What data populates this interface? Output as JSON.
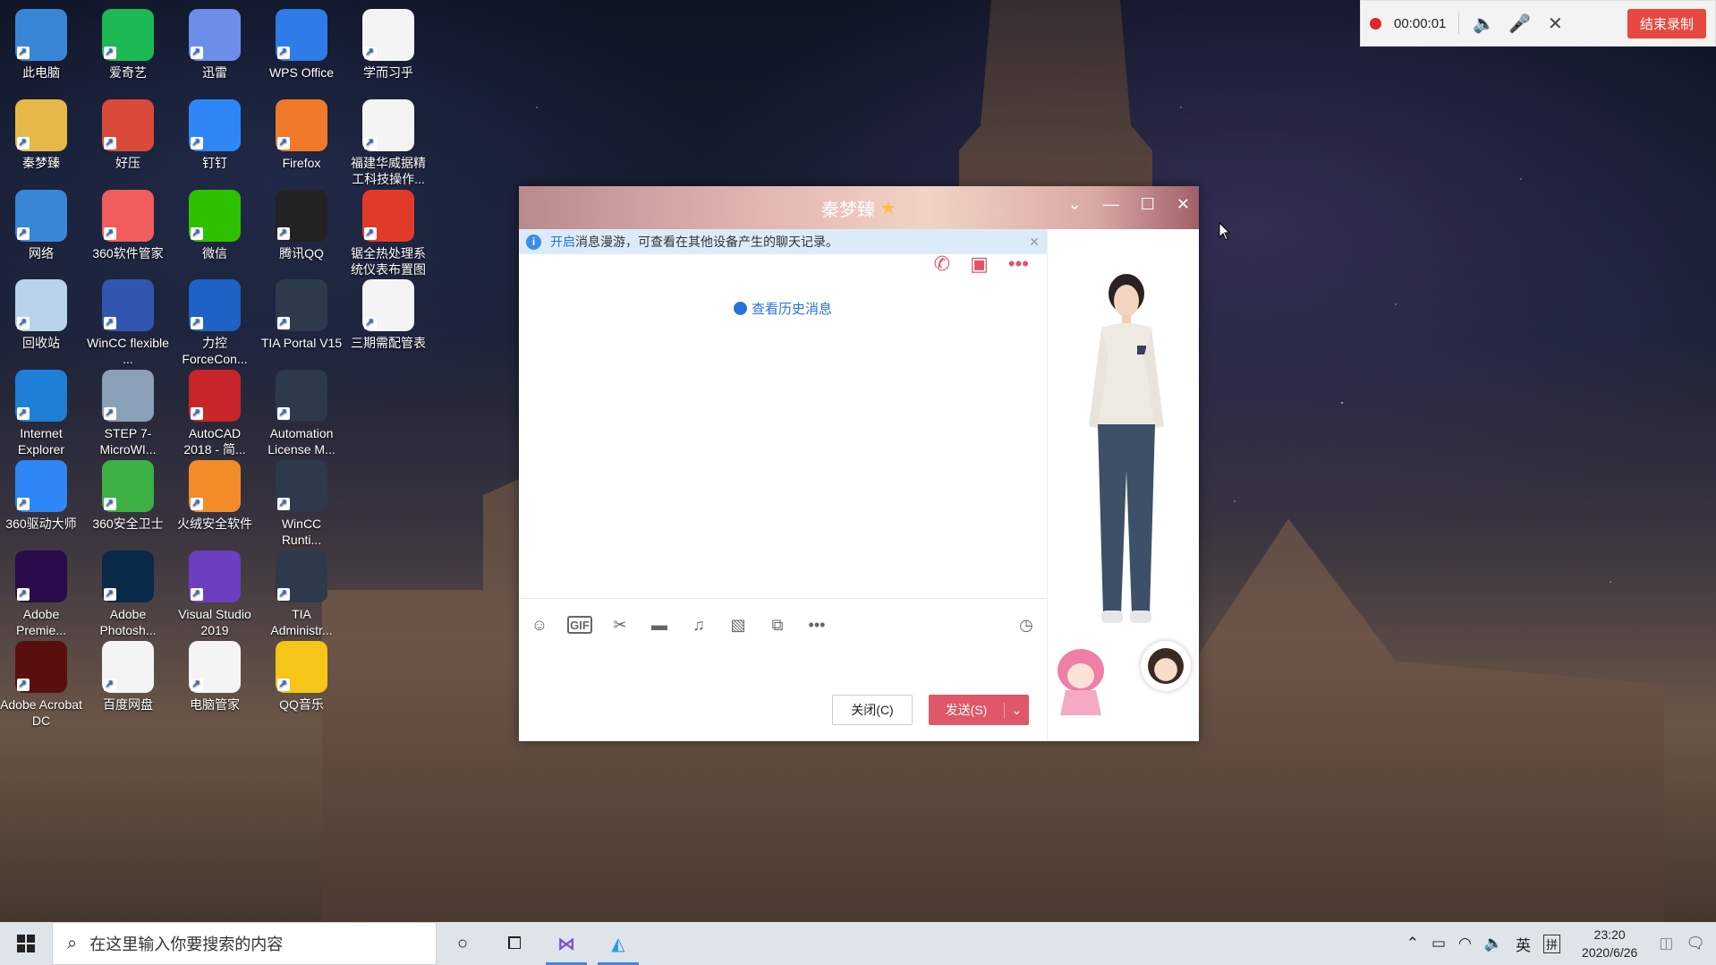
{
  "desktop": {
    "icons": [
      {
        "label": "此电脑",
        "icon": "computer-icon"
      },
      {
        "label": "爱奇艺",
        "icon": "iqiyi-icon"
      },
      {
        "label": "迅雷",
        "icon": "xunlei-icon"
      },
      {
        "label": "WPS Office",
        "icon": "wps-icon"
      },
      {
        "label": "学而习乎",
        "icon": "spreadsheet-icon"
      },
      {
        "label": "秦梦臻",
        "icon": "user-folder-icon"
      },
      {
        "label": "好压",
        "icon": "haozip-icon"
      },
      {
        "label": "钉钉",
        "icon": "dingtalk-icon"
      },
      {
        "label": "Firefox",
        "icon": "firefox-icon"
      },
      {
        "label": "福建华威据精工科技操作...",
        "icon": "word-doc-icon"
      },
      {
        "label": "网络",
        "icon": "network-icon"
      },
      {
        "label": "360软件管家",
        "icon": "360-software-icon"
      },
      {
        "label": "微信",
        "icon": "wechat-icon"
      },
      {
        "label": "腾讯QQ",
        "icon": "qq-icon"
      },
      {
        "label": "锯全热处理系统仪表布置图",
        "icon": "pdf-icon"
      },
      {
        "label": "回收站",
        "icon": "recycle-bin-icon"
      },
      {
        "label": "WinCC flexible ...",
        "icon": "wincc-flexible-icon"
      },
      {
        "label": "力控 ForceCon...",
        "icon": "forcecontrol-icon"
      },
      {
        "label": "TIA Portal V15",
        "icon": "tia-portal-icon"
      },
      {
        "label": "三期需配管表",
        "icon": "spreadsheet-icon"
      },
      {
        "label": "Internet Explorer",
        "icon": "ie-icon"
      },
      {
        "label": "STEP 7-MicroWI...",
        "icon": "step7-icon"
      },
      {
        "label": "AutoCAD 2018 - 简...",
        "icon": "autocad-icon"
      },
      {
        "label": "Automation License M...",
        "icon": "license-icon"
      },
      {
        "label": "360驱动大师",
        "icon": "360-driver-icon"
      },
      {
        "label": "360安全卫士",
        "icon": "360-safe-icon"
      },
      {
        "label": "火绒安全软件",
        "icon": "huorong-icon"
      },
      {
        "label": "WinCC Runti...",
        "icon": "wincc-runtime-icon"
      },
      {
        "label": "Adobe Premie...",
        "icon": "premiere-icon"
      },
      {
        "label": "Adobe Photosh...",
        "icon": "photoshop-icon"
      },
      {
        "label": "Visual Studio 2019",
        "icon": "visual-studio-icon"
      },
      {
        "label": "TIA Administr...",
        "icon": "tia-admin-icon"
      },
      {
        "label": "Adobe Acrobat DC",
        "icon": "acrobat-icon"
      },
      {
        "label": "百度网盘",
        "icon": "baidu-netdisk-icon"
      },
      {
        "label": "电脑管家",
        "icon": "pc-manager-icon"
      },
      {
        "label": "QQ音乐",
        "icon": "qq-music-icon"
      }
    ]
  },
  "recorder": {
    "time": "00:00:01",
    "end_label": "结束录制"
  },
  "chat": {
    "contact_name": "秦梦臻",
    "notice_link": "开启",
    "notice_text": "消息漫游，可查看在其他设备产生的聊天记录。",
    "history_link": "查看历史消息",
    "close_button": "关闭(C)",
    "send_button": "发送(S)",
    "gif_label": "GIF"
  },
  "taskbar": {
    "search_placeholder": "在这里输入你要搜索的内容",
    "ime_lang": "英",
    "ime_mode": "拼",
    "time": "23:20",
    "date": "2020/6/26"
  },
  "colors": {
    "accent_red": "#e05769",
    "link_blue": "#2a73d6",
    "notice_bg": "#dcebfa",
    "recorder_end": "#e8493e"
  }
}
